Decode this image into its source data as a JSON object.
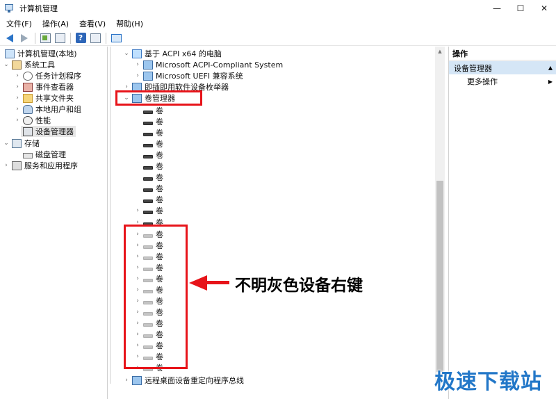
{
  "window": {
    "title": "计算机管理"
  },
  "menu": [
    "文件(F)",
    "操作(A)",
    "查看(V)",
    "帮助(H)"
  ],
  "left_tree": [
    {
      "label": "计算机管理(本地)",
      "icon": "computer-management-icon",
      "chev": ""
    },
    {
      "label": "系统工具",
      "icon": "system-tools-icon",
      "chev": "v"
    },
    {
      "label": "任务计划程序",
      "icon": "task-scheduler-icon",
      "chev": ">"
    },
    {
      "label": "事件查看器",
      "icon": "event-viewer-icon",
      "chev": ">"
    },
    {
      "label": "共享文件夹",
      "icon": "shared-folders-icon",
      "chev": ">"
    },
    {
      "label": "本地用户和组",
      "icon": "local-users-icon",
      "chev": ">"
    },
    {
      "label": "性能",
      "icon": "performance-icon",
      "chev": ">"
    },
    {
      "label": "设备管理器",
      "icon": "device-manager-icon",
      "chev": ""
    },
    {
      "label": "存储",
      "icon": "storage-icon",
      "chev": "v"
    },
    {
      "label": "磁盘管理",
      "icon": "disk-management-icon",
      "chev": ""
    },
    {
      "label": "服务和应用程序",
      "icon": "services-icon",
      "chev": ">"
    }
  ],
  "device_tree": {
    "computer": "基于 ACPI x64 的电脑",
    "acpi": "Microsoft ACPI-Compliant System",
    "uefi": "Microsoft UEFI 兼容系统",
    "pnp": "即插即用软件设备枚举器",
    "volume_manager": "卷管理器",
    "volume_label": "卷",
    "remote": "远程桌面设备重定向程序总线"
  },
  "actions": {
    "header": "操作",
    "selected": "设备管理器",
    "more": "更多操作"
  },
  "annotation": {
    "callout": "不明灰色设备右键"
  },
  "watermark": "极速下载站",
  "colors": {
    "annotation_red": "#e7141a",
    "watermark_blue": "#2277c8",
    "action_selected": "#d5e6f6"
  }
}
